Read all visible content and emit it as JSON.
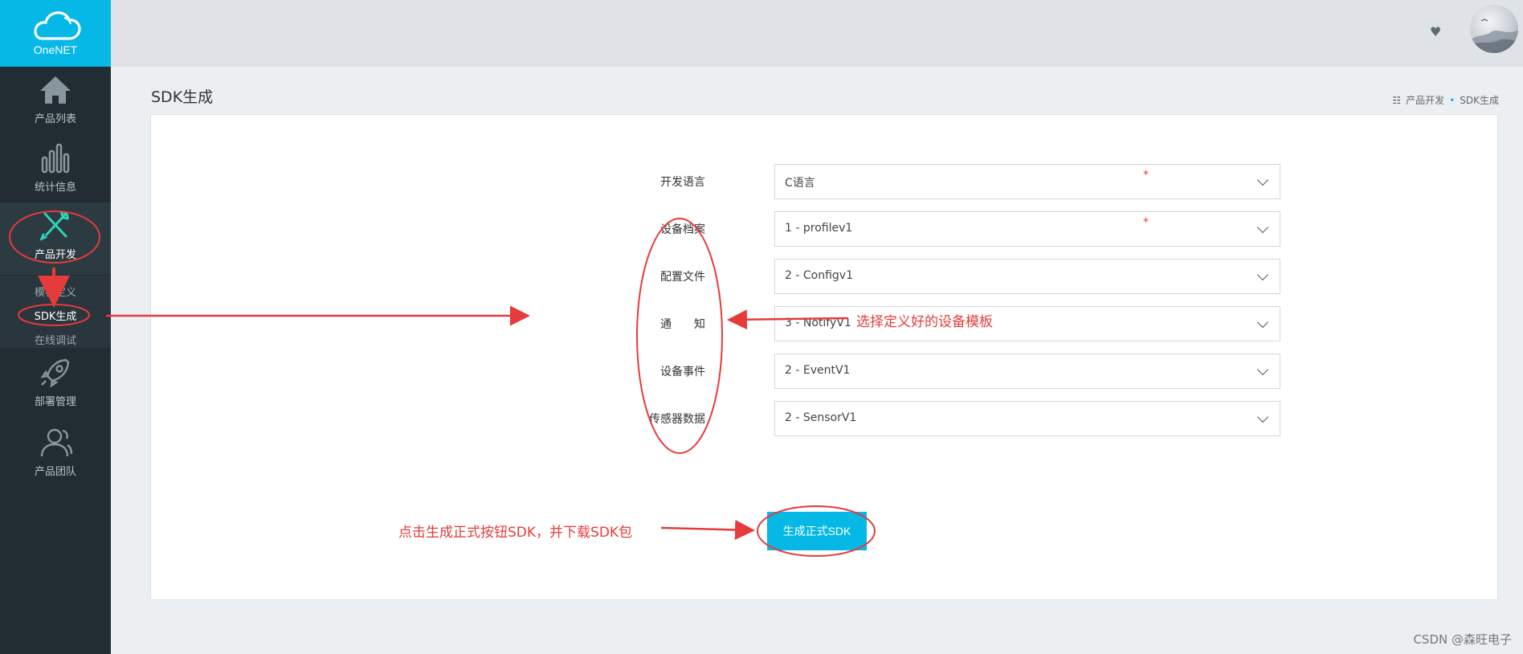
{
  "brand": {
    "logo_text": "OneNET"
  },
  "sidebar": {
    "items": [
      {
        "label": "产品列表",
        "icon": "home-icon"
      },
      {
        "label": "统计信息",
        "icon": "bar-chart-icon"
      },
      {
        "label": "产品开发",
        "icon": "tools-icon"
      },
      {
        "label": "部署管理",
        "icon": "rocket-icon"
      },
      {
        "label": "产品团队",
        "icon": "team-icon"
      }
    ],
    "sub_items": [
      {
        "label": "模板定义"
      },
      {
        "label": "SDK生成"
      },
      {
        "label": "在线调试"
      }
    ]
  },
  "header": {
    "heart_icon": "heart-icon",
    "avatar_icon": "avatar-icon"
  },
  "page": {
    "title": "SDK生成",
    "breadcrumb": [
      "产品开发",
      "SDK生成"
    ]
  },
  "form": {
    "fields": [
      {
        "label": "开发语言",
        "value": "C语言",
        "required": true
      },
      {
        "label": "设备档案",
        "value": "1 - profilev1",
        "required": true
      },
      {
        "label": "配置文件",
        "value": "2 - Configv1",
        "required": false
      },
      {
        "label": "通　　知",
        "value": "3 - NotifyV1",
        "required": false
      },
      {
        "label": "设备事件",
        "value": "2 - EventV1",
        "required": false
      },
      {
        "label": "传感器数据",
        "value": "2 - SensorV1",
        "required": false
      }
    ],
    "required_mark": "*",
    "submit_label": "生成正式SDK"
  },
  "annotations": {
    "choose_template": "选择定义好的设备模板",
    "click_generate": "点击生成正式按钮SDK，并下载SDK包",
    "color": "#e63b3b"
  },
  "watermark": "CSDN @森旺电子",
  "colors": {
    "accent": "#06b8e6",
    "sidebar": "#222d33"
  }
}
